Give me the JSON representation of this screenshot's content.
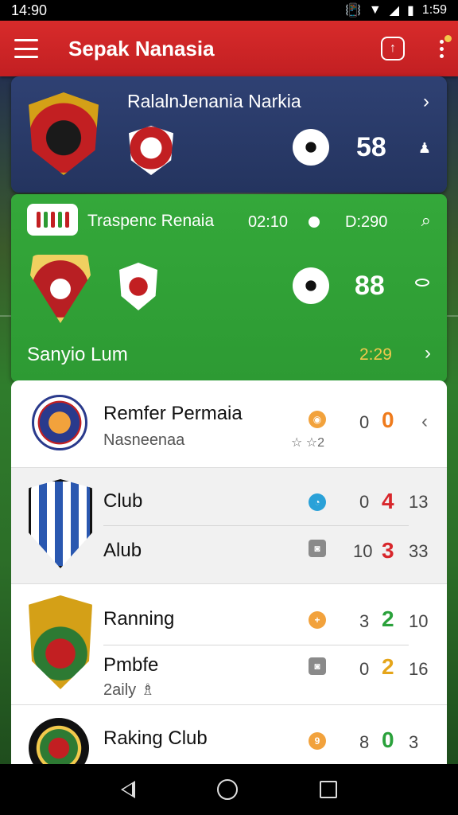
{
  "status_bar": {
    "time_left": "14:90",
    "time_right": "1:59",
    "icons": [
      "vibrate-icon",
      "wifi-icon",
      "signal-icon",
      "battery-icon"
    ]
  },
  "app_bar": {
    "title": "Sepak Nanasia",
    "icons": [
      "menu-icon",
      "share-icon",
      "more-icon"
    ],
    "share_glyph": "↑"
  },
  "featured_match": {
    "title": "RalalnJenania Narkia",
    "score": "58",
    "chevron": "›",
    "bell": "♟"
  },
  "live_match": {
    "title": "Traspenc Renaia",
    "time_start": "02:10",
    "time_end": "D:290",
    "score": "88",
    "subtitle": "Sanyio Lum",
    "subtitle_time": "2:29",
    "chevron": "›",
    "search_glyph": "⌕"
  },
  "match_list": [
    {
      "team": "Remfer Permaia",
      "sub": "Nasneenaa",
      "stars": "☆ ☆2",
      "v1": "0",
      "v2": "0",
      "chevron": "‹",
      "mini_glyph": "◉"
    },
    {
      "team_a": "Club",
      "team_b": "Alub",
      "a": {
        "v1": "0",
        "v2": "4",
        "v3": "13",
        "glyph": "◔"
      },
      "b": {
        "v1": "10",
        "v2": "3",
        "v3": "33",
        "glyph": "◙"
      }
    },
    {
      "team_a": "Ranning",
      "team_b": "Pmbfe",
      "sub": "2aily ♗",
      "a": {
        "v1": "3",
        "v2": "2",
        "v3": "10",
        "glyph": "+"
      },
      "b": {
        "v1": "0",
        "v2": "2",
        "v3": "16",
        "glyph": "◙"
      }
    },
    {
      "team": "Raking Club",
      "v1": "8",
      "v2": "0",
      "v3": "3",
      "mini_glyph": "9"
    }
  ]
}
